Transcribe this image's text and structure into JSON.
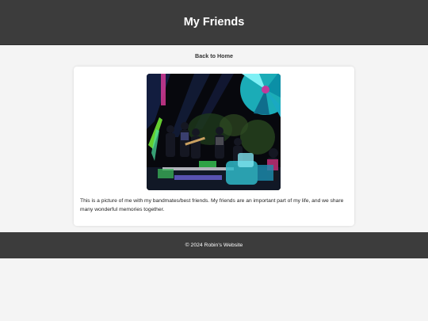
{
  "header": {
    "title": "My Friends"
  },
  "nav": {
    "back_label": "Back to Home"
  },
  "main": {
    "caption": "This is a picture of me with my bandmates/best friends. My friends are an important part of my life, and we share many wonderful memories together."
  },
  "footer": {
    "text": "© 2024 Robin's Website"
  },
  "colors": {
    "header_bg": "#3c3c3c",
    "page_bg": "#f4f4f4",
    "card_bg": "#ffffff"
  }
}
